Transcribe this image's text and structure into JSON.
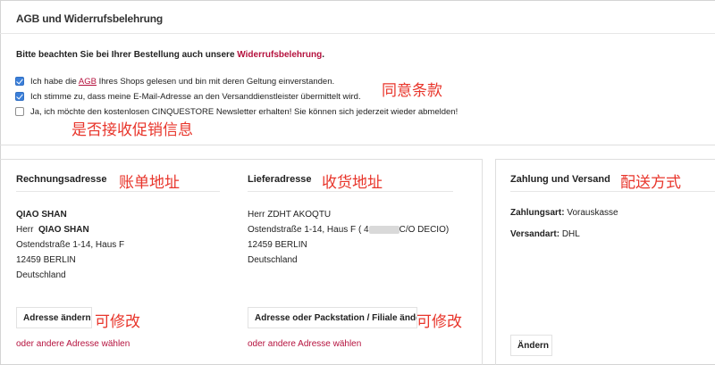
{
  "agb": {
    "title": "AGB und Widerrufsbelehrung",
    "note_text": "Bitte beachten Sie bei Ihrer Bestellung auch unsere ",
    "note_link": "Widerrufsbelehrung",
    "note_end": ".",
    "checkboxes": [
      {
        "checked": true,
        "before": "Ich habe die ",
        "link": "AGB",
        "after": " Ihres Shops gelesen und bin mit deren Geltung einverstanden."
      },
      {
        "checked": true,
        "before": "Ich stimme zu, dass meine E-Mail-Adresse an den Versanddienstleister übermittelt wird.",
        "link": "",
        "after": ""
      },
      {
        "checked": false,
        "before": "Ja, ich möchte den kostenlosen CINQUESTORE Newsletter erhalten! Sie können sich jederzeit wieder abmelden!",
        "link": "",
        "after": ""
      }
    ]
  },
  "billing": {
    "title": "Rechnungsadresse",
    "name_upper": "QIAO SHAN",
    "salutation": "Herr",
    "name": "QIAO SHAN",
    "street": "Ostendstraße 1-14, Haus F",
    "city": "12459 BERLIN",
    "country": "Deutschland",
    "change_button": "Adresse ändern",
    "other_link": "oder andere Adresse wählen"
  },
  "shipping": {
    "title": "Lieferadresse",
    "salutation_name": "Herr ZDHT AKOQTU",
    "street_before": "Ostendstraße 1-14, Haus F ( 4",
    "street_after": "C/O DECIO)",
    "city": "12459 BERLIN",
    "country": "Deutschland",
    "change_button": "Adresse oder Packstation / Filiale ändern",
    "other_link": "oder andere Adresse wählen"
  },
  "payment": {
    "title": "Zahlung und Versand",
    "payment_label": "Zahlungsart:",
    "payment_value": "Vorauskasse",
    "shipping_label": "Versandart:",
    "shipping_value": "DHL",
    "change_button": "Ändern"
  },
  "annotations": {
    "agree_terms": "同意条款",
    "newsletter": "是否接收促销信息",
    "billing": "账单地址",
    "shipping": "收货地址",
    "delivery_method": "配送方式",
    "editable_1": "可修改",
    "editable_2": "可修改"
  },
  "colors": {
    "link_red": "#b5123e",
    "annotation_red": "#e8352b",
    "checkbox_blue": "#3b7fd9"
  }
}
